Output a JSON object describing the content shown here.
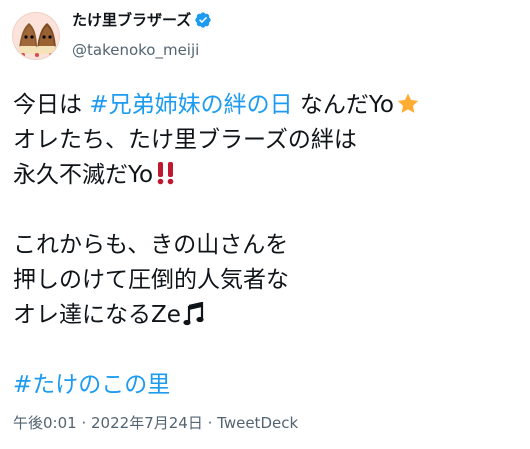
{
  "author": {
    "display_name": "たけ里ブラザーズ",
    "handle": "@takenoko_meiji",
    "verified": true,
    "avatar_icon": "takenoko-brothers-avatar"
  },
  "tweet": {
    "line1_prefix": "今日は ",
    "line1_hashtag": "#兄弟姉妹の絆の日",
    "line1_suffix": " なんだYo",
    "line2": "オレたち、たけ里ブラーズの絆は",
    "line3": "永久不滅だYo",
    "line5": "これからも、きの山さんを",
    "line6": "押しのけて圧倒的人気者な",
    "line7": "オレ達になるZe",
    "hashtag2": "#たけのこの里"
  },
  "meta": {
    "time": "午後0:01",
    "date": "2022年7月24日",
    "source": "TweetDeck"
  },
  "colors": {
    "link": "#1d9bf0",
    "verified": "#1d9bf0",
    "muted": "#536471",
    "text": "#0f1419"
  }
}
